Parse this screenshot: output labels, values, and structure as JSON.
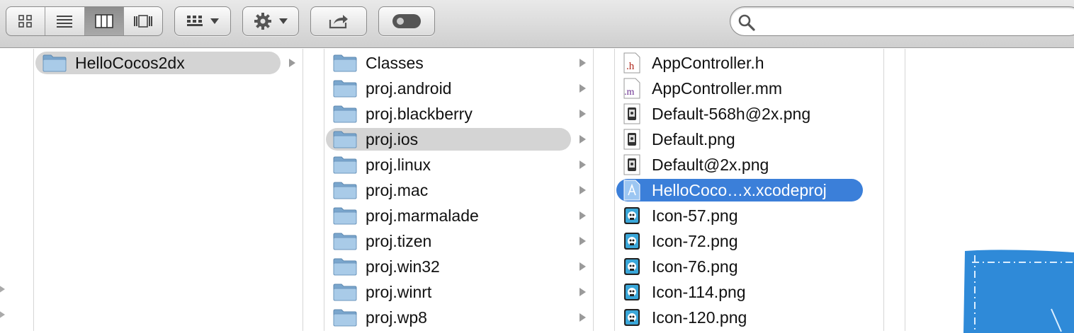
{
  "toolbar": {
    "view_buttons": [
      {
        "icon": "icon-view-icon",
        "active": false
      },
      {
        "icon": "list-view-icon",
        "active": false
      },
      {
        "icon": "column-view-icon",
        "active": true
      },
      {
        "icon": "cover-flow-icon",
        "active": false
      }
    ],
    "arrange_icon": "arrange-icon",
    "action_icon": "gear-icon",
    "share_icon": "share-icon",
    "toggle_icon": "toggle-icon",
    "search": {
      "icon": "search-icon",
      "placeholder": ""
    }
  },
  "column1": {
    "items": [
      {
        "name": "HelloCocos2dx",
        "type": "folder",
        "state": "highlighted",
        "has_children": true
      }
    ]
  },
  "column2": {
    "items": [
      {
        "name": "Classes",
        "type": "folder",
        "has_children": true
      },
      {
        "name": "proj.android",
        "type": "folder",
        "has_children": true
      },
      {
        "name": "proj.blackberry",
        "type": "folder",
        "has_children": true
      },
      {
        "name": "proj.ios",
        "type": "folder",
        "state": "highlighted",
        "has_children": true
      },
      {
        "name": "proj.linux",
        "type": "folder",
        "has_children": true
      },
      {
        "name": "proj.mac",
        "type": "folder",
        "has_children": true
      },
      {
        "name": "proj.marmalade",
        "type": "folder",
        "has_children": true
      },
      {
        "name": "proj.tizen",
        "type": "folder",
        "has_children": true
      },
      {
        "name": "proj.win32",
        "type": "folder",
        "has_children": true
      },
      {
        "name": "proj.winrt",
        "type": "folder",
        "has_children": true
      },
      {
        "name": "proj.wp8",
        "type": "folder",
        "has_children": true
      }
    ]
  },
  "column3": {
    "items": [
      {
        "name": "AppController.h",
        "type": "h-file",
        "icon_label": ".h"
      },
      {
        "name": "AppController.mm",
        "type": "mm-file",
        "icon_label": ".m"
      },
      {
        "name": "Default-568h@2x.png",
        "type": "png-file"
      },
      {
        "name": "Default.png",
        "type": "png-file"
      },
      {
        "name": "Default@2x.png",
        "type": "png-file"
      },
      {
        "name": "HelloCoco…x.xcodeproj",
        "type": "xcodeproj",
        "state": "selected"
      },
      {
        "name": "Icon-57.png",
        "type": "app-icon"
      },
      {
        "name": "Icon-72.png",
        "type": "app-icon"
      },
      {
        "name": "Icon-76.png",
        "type": "app-icon"
      },
      {
        "name": "Icon-114.png",
        "type": "app-icon"
      },
      {
        "name": "Icon-120.png",
        "type": "app-icon"
      }
    ]
  },
  "preview": {
    "icon": "xcode-project-blueprint-icon"
  },
  "colors": {
    "selection": "#3b7fd9",
    "highlight": "#d4d4d4",
    "folder": "#8fb8dc"
  }
}
